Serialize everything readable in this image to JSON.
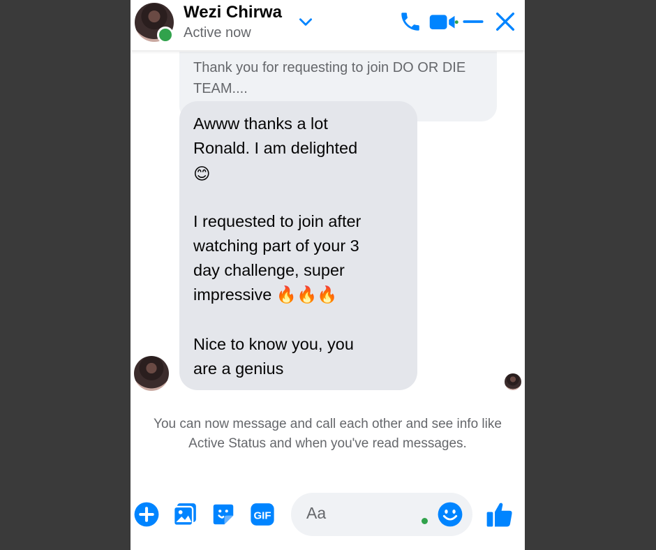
{
  "header": {
    "name": "Wezi Chirwa",
    "status": "Active now",
    "icons": [
      "chevron-down-icon",
      "phone-icon",
      "video-call-icon",
      "minimize-icon",
      "close-icon"
    ],
    "accent_color": "#0084ff",
    "online_color": "#31a24c"
  },
  "messages": {
    "previous_text": "Thank you for requesting to join DO OR DIE TEAM....",
    "main_lines": [
      "Awww thanks a lot",
      "Ronald. I am delighted",
      "😊",
      "I requested to join after",
      "watching part of your 3",
      "day challenge, super",
      "impressive 🔥🔥🔥",
      "Nice to know you, you",
      "are a genius"
    ]
  },
  "system_message": "You can now message and call each other and see info like Active Status and when you've read messages.",
  "composer": {
    "placeholder": "Aa",
    "icons": [
      "plus-icon",
      "photo-icon",
      "sticker-icon",
      "gif-icon",
      "emoji-icon",
      "thumbs-up-icon"
    ],
    "gif_label": "GIF"
  }
}
